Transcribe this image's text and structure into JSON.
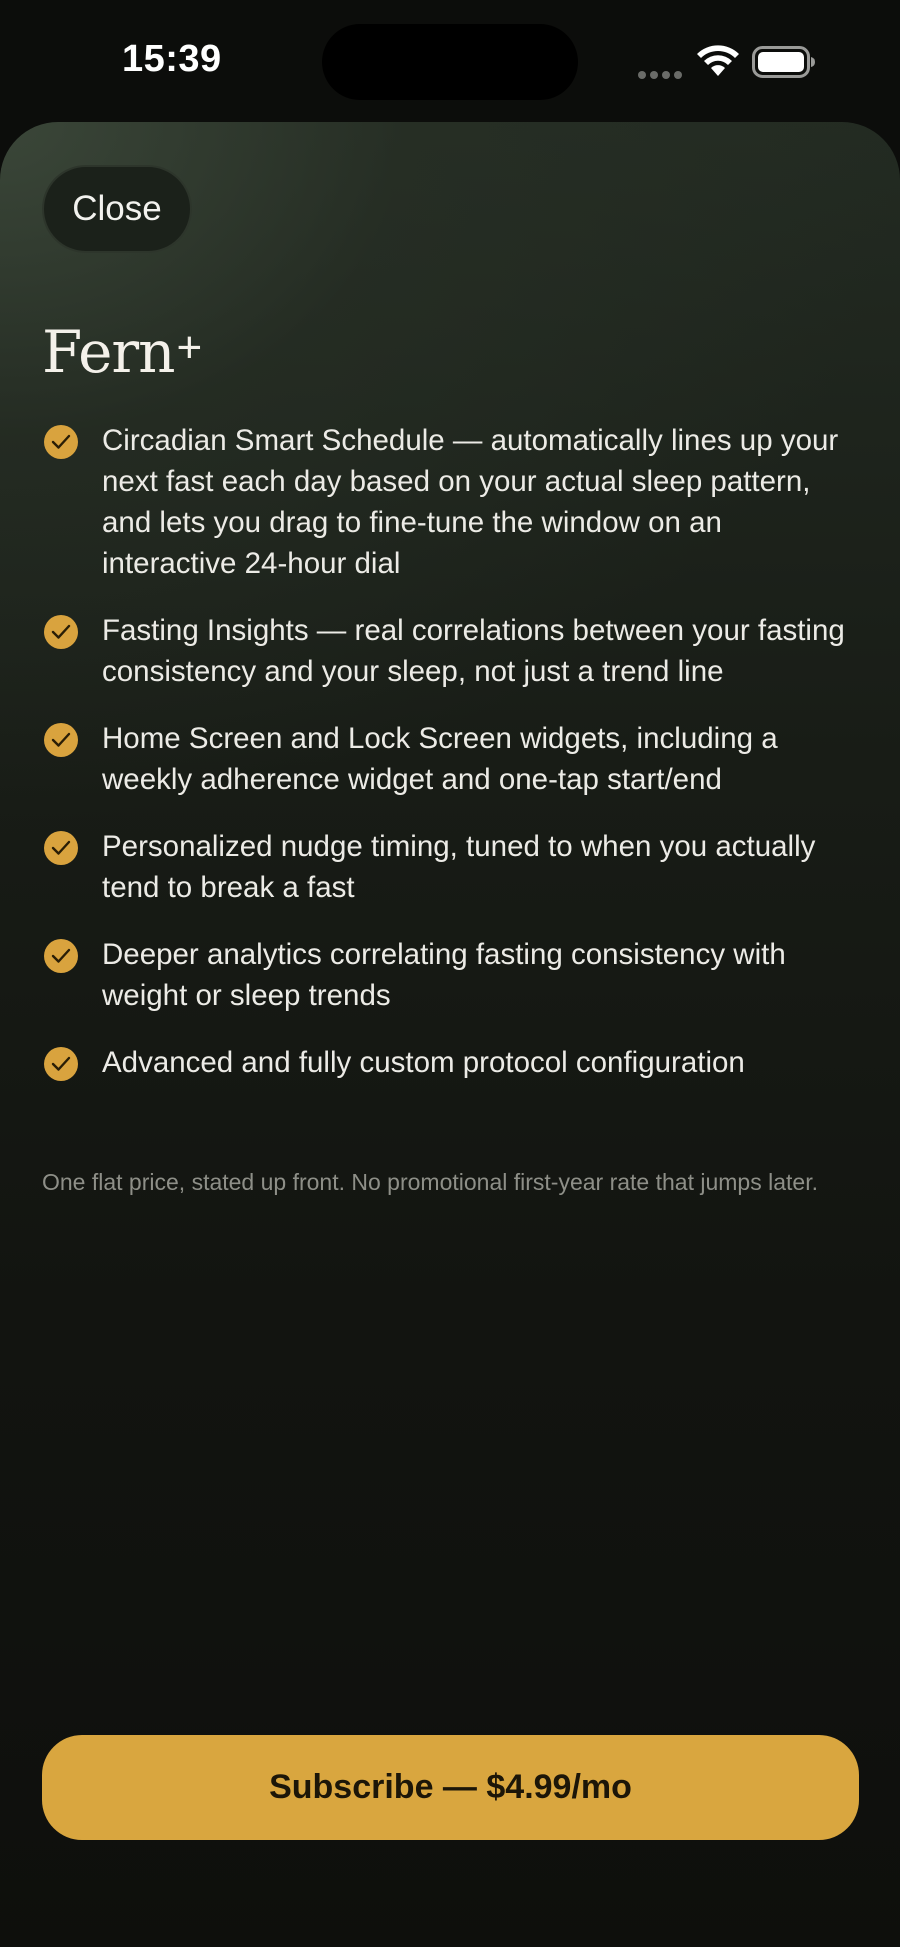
{
  "status_bar": {
    "time": "15:39"
  },
  "sheet": {
    "close_label": "Close",
    "title": "Fern",
    "title_suffix": "+",
    "features": [
      "Circadian Smart Schedule — automatically lines up your next fast each day based on your actual sleep pattern, and lets you drag to fine-tune the window on an interactive 24-hour dial",
      "Fasting Insights — real correlations between your fasting consistency and your sleep, not just a trend line",
      "Home Screen and Lock Screen widgets, including a weekly adherence widget and one-tap start/end",
      "Personalized nudge timing, tuned to when you actually tend to break a fast",
      "Deeper analytics correlating fasting consistency with weight or sleep trends",
      "Advanced and fully custom protocol configuration"
    ],
    "note": "One flat price, stated up front. No promotional first-year rate that jumps later.",
    "subscribe_label": "Subscribe — $4.99/mo"
  },
  "colors": {
    "accent": "#d9a63f",
    "check": "#d9a33e",
    "background": "#0c0d0b",
    "sheet_top": "#232b22"
  },
  "icons": {
    "feature_check": "checkmark-circle-icon",
    "wifi": "wifi-icon",
    "battery": "battery-icon",
    "signal": "signal-icon"
  }
}
